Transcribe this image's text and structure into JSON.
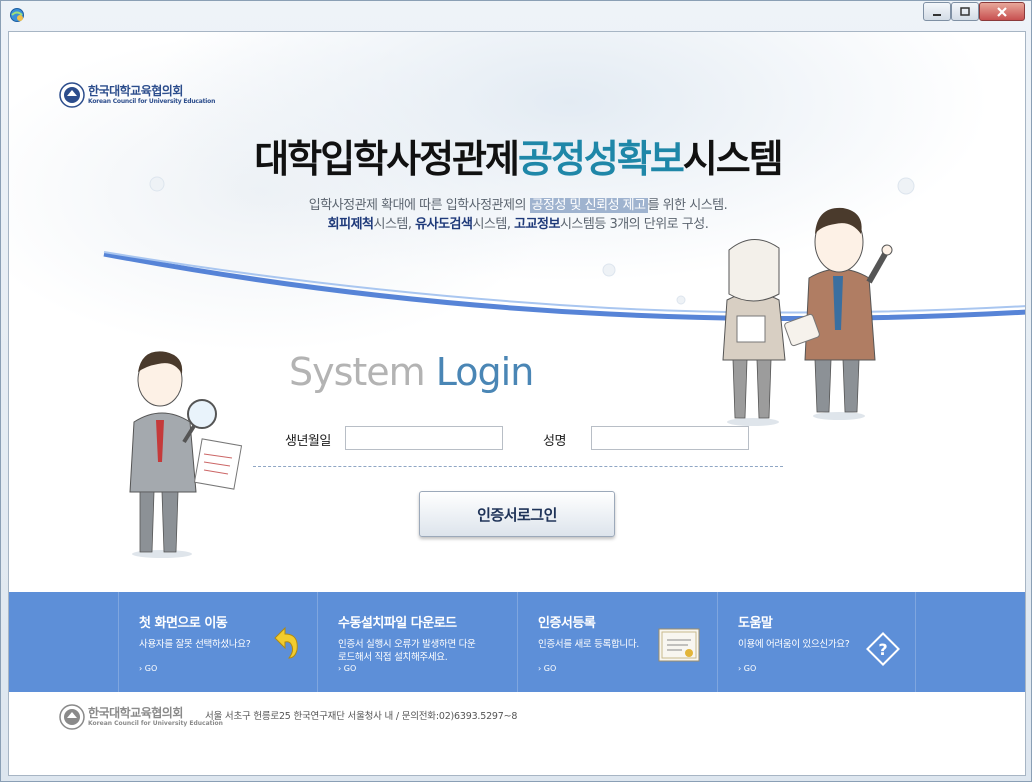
{
  "window": {
    "controls": [
      "minimize",
      "maximize",
      "close"
    ]
  },
  "logo": {
    "ko": "한국대학교육협의회",
    "en": "Korean Council for University Education"
  },
  "header": {
    "title_part1": "대학입학사정관제",
    "title_part2": "공정성확보",
    "title_part3": "시스템",
    "desc_line1_a": "입학사정관제 확대에 따른 입학사정관제의 ",
    "desc_line1_highlight": "공정성 및 신뢰성 제고",
    "desc_line1_b": "를 위한 시스템.",
    "desc_line2_sys1": "회피제척",
    "desc_line2_t1": "시스템, ",
    "desc_line2_sys2": "유사도검색",
    "desc_line2_t2": "시스템, ",
    "desc_line2_sys3": "고교정보",
    "desc_line2_t3": "시스템등 3개의 단위로 구성."
  },
  "login": {
    "heading_part1": "System ",
    "heading_part2": "Login",
    "birth_label": "생년월일",
    "birth_value": "",
    "name_label": "성명",
    "name_value": "",
    "submit_label": "인증서로그인"
  },
  "panels": [
    {
      "title": "첫 화면으로 이동",
      "text": "사용자를 잘못 선택하셨나요?",
      "go": "› GO",
      "icon": "back-arrow-icon"
    },
    {
      "title": "수동설치파일 다운로드",
      "text": "인증서 실행시 오류가 발생하면 다운로드해서 직접 설치해주세요.",
      "go": "› GO",
      "icon": ""
    },
    {
      "title": "인증서등록",
      "text": "인증서를 새로 등록합니다.",
      "go": "› GO",
      "icon": "certificate-icon"
    },
    {
      "title": "도움말",
      "text": "이용에 어려움이 있으신가요?",
      "go": "› GO",
      "icon": "question-icon"
    }
  ],
  "footer": {
    "logo_ko": "한국대학교육협의회",
    "logo_en": "Korean Council for University Education",
    "address": "서울 서초구 헌릉로25 한국연구재단 서울청사 내   /  문의전화:02)6393.5297~8"
  },
  "colors": {
    "accent": "#1f87a8",
    "band": "#5d8fd8",
    "navy": "#1f3a7a"
  }
}
